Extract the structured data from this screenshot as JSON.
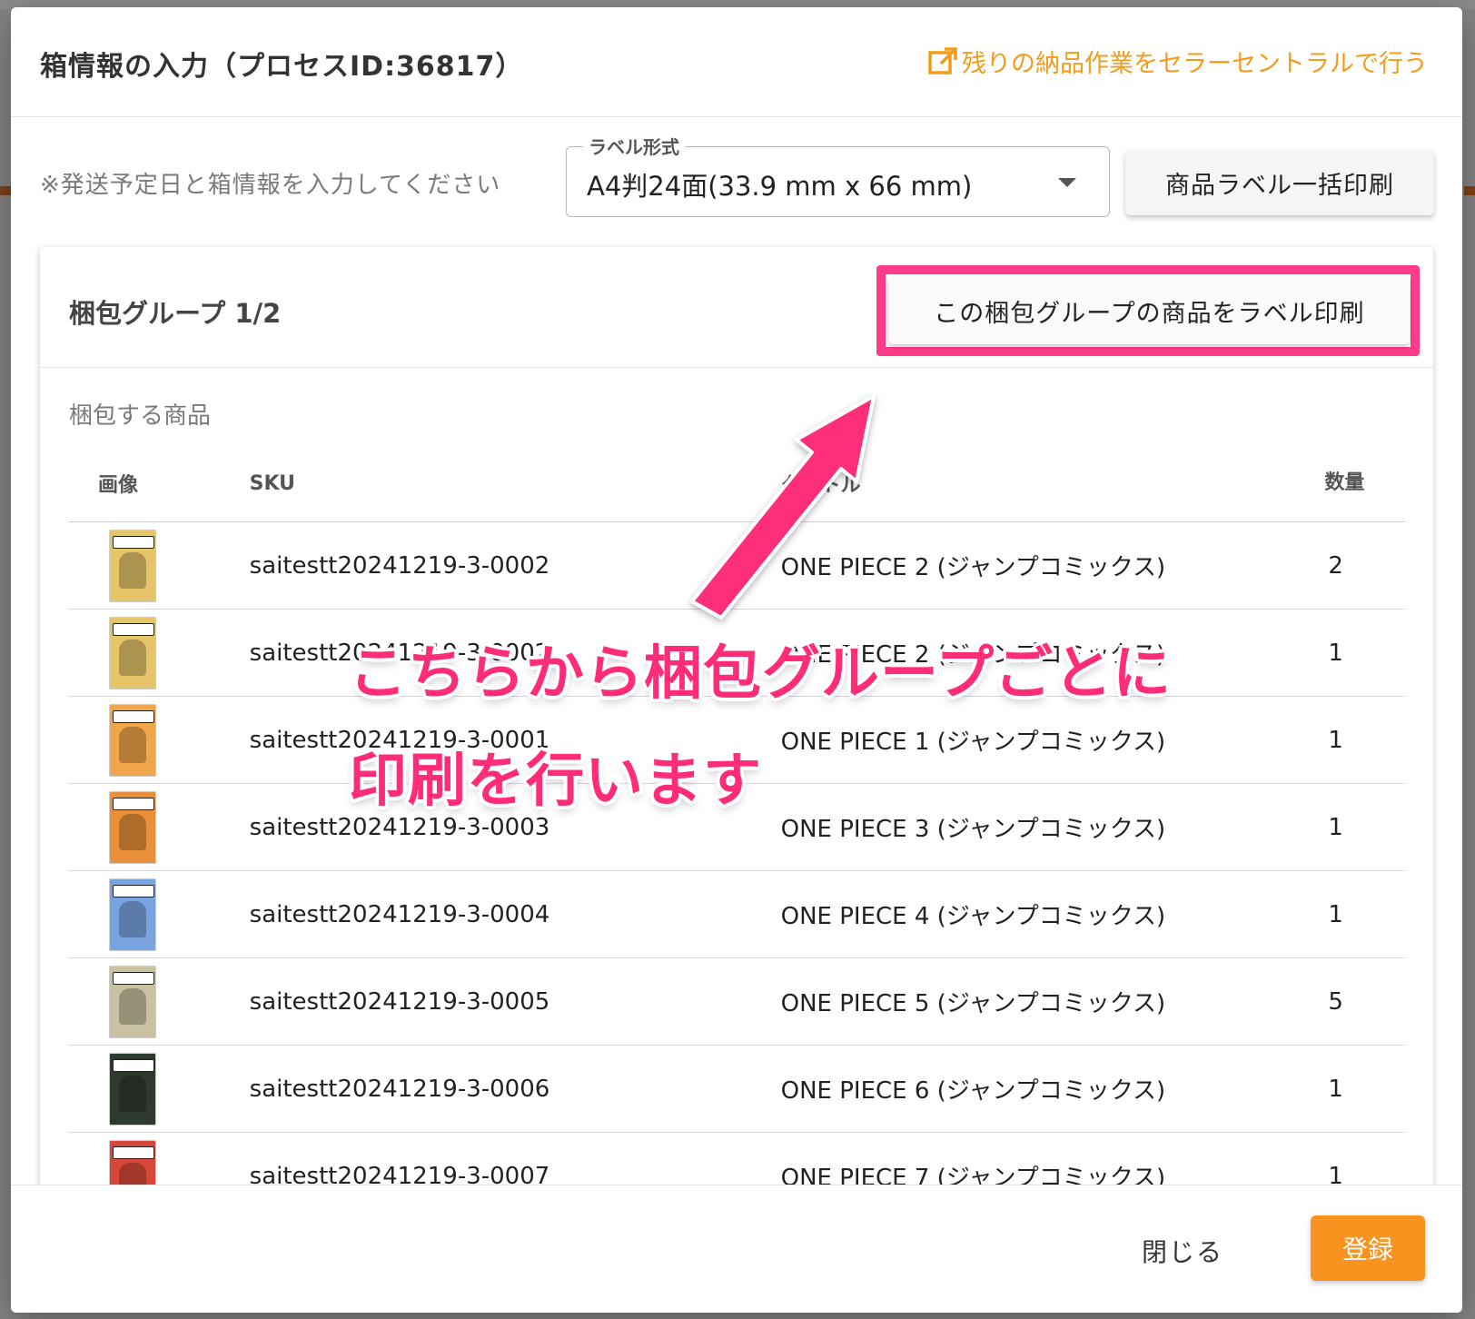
{
  "modal": {
    "title": "箱情報の入力（プロセスID:36817）",
    "seller_central_link": "残りの納品作業をセラーセントラルで行う",
    "hint": "※発送予定日と箱情報を入力してください",
    "label_format": {
      "legend": "ラベル形式",
      "selected": "A4判24面(33.9 mm x 66 mm)"
    },
    "print_all_button": "商品ラベル一括印刷"
  },
  "group": {
    "title": "梱包グループ 1/2",
    "print_group_button": "この梱包グループの商品をラベル印刷",
    "section_label": "梱包する商品",
    "columns": {
      "image": "画像",
      "sku": "SKU",
      "title": "タイトル",
      "qty": "数量"
    },
    "rows": [
      {
        "sku": "saitestt20241219-3-0002",
        "title": "ONE PIECE 2 (ジャンプコミックス)",
        "qty": "2",
        "cover": "#e6c46a"
      },
      {
        "sku": "saitestt20241219-3-0002",
        "title": "ONE PIECE 2 (ジャンプコミックス)",
        "qty": "1",
        "cover": "#e6c46a"
      },
      {
        "sku": "saitestt20241219-3-0001",
        "title": "ONE PIECE 1 (ジャンプコミックス)",
        "qty": "1",
        "cover": "#f0a64a"
      },
      {
        "sku": "saitestt20241219-3-0003",
        "title": "ONE PIECE 3 (ジャンプコミックス)",
        "qty": "1",
        "cover": "#e8903a"
      },
      {
        "sku": "saitestt20241219-3-0004",
        "title": "ONE PIECE 4 (ジャンプコミックス)",
        "qty": "1",
        "cover": "#7aa4e0"
      },
      {
        "sku": "saitestt20241219-3-0005",
        "title": "ONE PIECE 5 (ジャンプコミックス)",
        "qty": "5",
        "cover": "#c9c2a2"
      },
      {
        "sku": "saitestt20241219-3-0006",
        "title": "ONE PIECE 6 (ジャンプコミックス)",
        "qty": "1",
        "cover": "#2f3a2f"
      },
      {
        "sku": "saitestt20241219-3-0007",
        "title": "ONE PIECE 7 (ジャンプコミックス)",
        "qty": "1",
        "cover": "#d8483a"
      }
    ]
  },
  "footer": {
    "close": "閉じる",
    "submit": "登録"
  },
  "annotation": {
    "line1": "こちらから梱包グループごとに",
    "line2": "印刷を行います",
    "color": "#ff2d78"
  },
  "colors": {
    "accent_orange": "#f7931e",
    "highlight_pink": "#ff3b8a"
  }
}
